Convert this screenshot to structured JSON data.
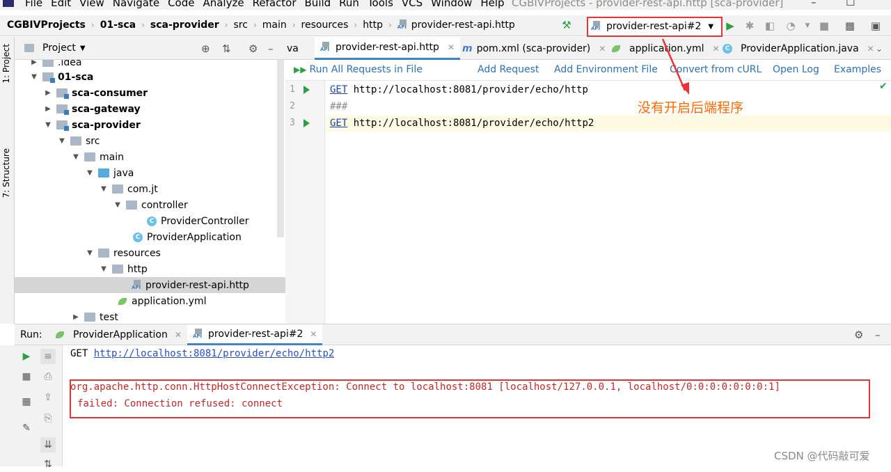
{
  "menubar": {
    "items": [
      "File",
      "Edit",
      "View",
      "Navigate",
      "Code",
      "Analyze",
      "Refactor",
      "Build",
      "Run",
      "Tools",
      "VCS",
      "Window",
      "Help"
    ],
    "window_title": "CGBIVProjects - provider-rest-api.http [sca-provider]",
    "minimize": "–",
    "maximize": "☐"
  },
  "breadcrumbs": [
    "CGBIVProjects",
    "01-sca",
    "sca-provider",
    "src",
    "main",
    "resources",
    "http",
    "provider-rest-api.http"
  ],
  "run_config": {
    "label": "provider-rest-api#2"
  },
  "left_strip": {
    "project_tab": "1: Project",
    "structure_tab": "7: Structure"
  },
  "project_panel": {
    "title": "Project",
    "tree": [
      ".idea",
      "01-sca",
      "sca-consumer",
      "sca-gateway",
      "sca-provider",
      "src",
      "main",
      "java",
      "com.jt",
      "controller",
      "ProviderController",
      "ProviderApplication",
      "resources",
      "http",
      "provider-rest-api.http",
      "application.yml",
      "test"
    ]
  },
  "editor_tabs": [
    "va",
    "provider-rest-api.http",
    "pom.xml (sca-provider)",
    "application.yml",
    "ProviderApplication.java"
  ],
  "http_toolbar": {
    "run_all": "Run All Requests in File",
    "add_request": "Add Request",
    "add_env": "Add Environment File",
    "convert": "Convert from cURL",
    "open_log": "Open Log",
    "examples": "Examples"
  },
  "code": {
    "line_numbers": [
      "1",
      "2",
      "3"
    ],
    "line1_method": "GET",
    "line1_url": " http://localhost:8081/provider/echo/http",
    "line2": "###",
    "line3_method": "GET",
    "line3_url": " http://localhost:8081/provider/echo/http2"
  },
  "annotation": "没有开启后端程序",
  "run_panel": {
    "label": "Run:",
    "tabs": [
      "ProviderApplication",
      "provider-rest-api#2"
    ],
    "console_method": "GET ",
    "console_url": "http://localhost:8081/provider/echo/http2",
    "error_line1": "org.apache.http.conn.HttpHostConnectException: Connect to localhost:8081 [localhost/127.0.0.1, localhost/0:0:0:0:0:0:0:1]",
    "error_line2": "failed: Connection refused: connect"
  },
  "watermark": "CSDN @代码敲可爱",
  "colors": {
    "accent": "#4083c9",
    "error": "#c0282a",
    "highlight_box": "#e83333",
    "annotation": "#ff6a00"
  }
}
